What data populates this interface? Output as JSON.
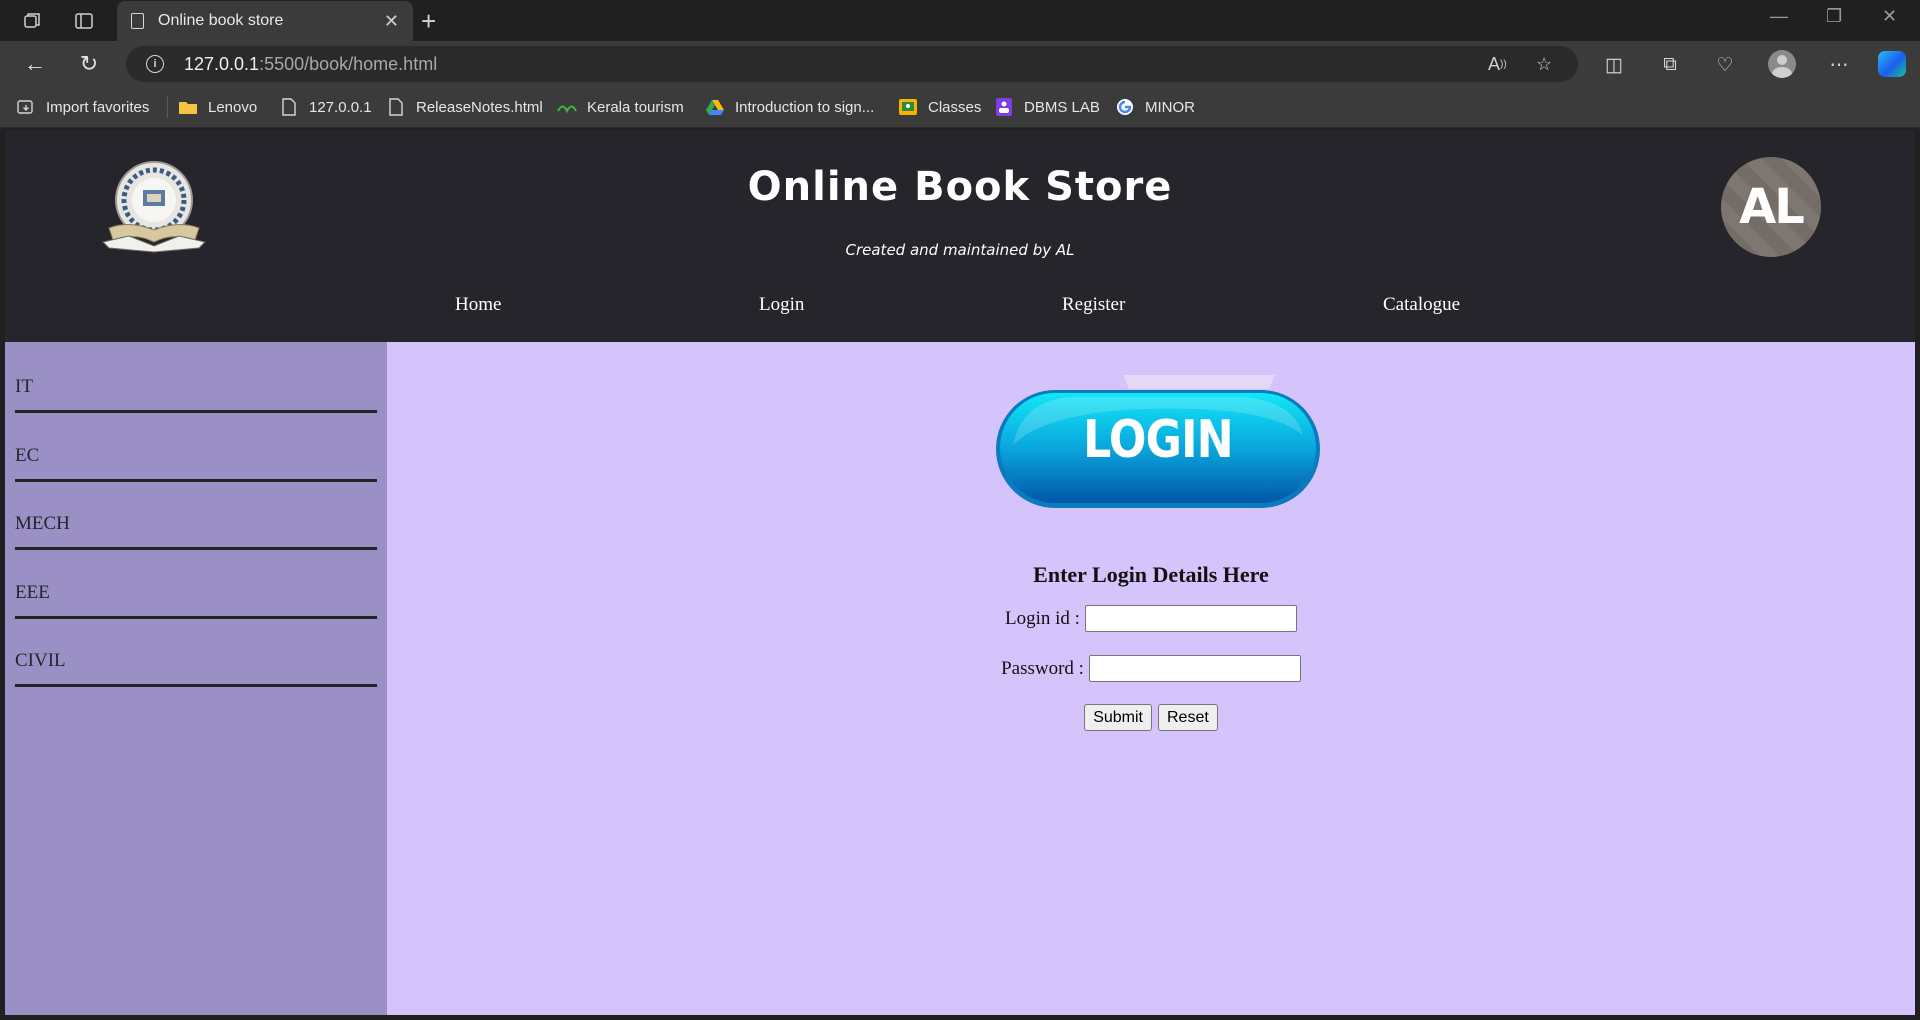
{
  "browser": {
    "tab_title": "Online book store",
    "url_host": "127.0.0.1",
    "url_path": ":5500/book/home.html",
    "bookmarks": [
      {
        "label": "Import favorites",
        "icon": "import-icon"
      },
      {
        "label": "Lenovo",
        "icon": "folder-icon"
      },
      {
        "label": "127.0.0.1",
        "icon": "page-icon"
      },
      {
        "label": "ReleaseNotes.html",
        "icon": "page-icon"
      },
      {
        "label": "Kerala tourism",
        "icon": "kerala-icon"
      },
      {
        "label": "Introduction to sign...",
        "icon": "drive-icon"
      },
      {
        "label": "Classes",
        "icon": "classroom-icon"
      },
      {
        "label": "DBMS LAB",
        "icon": "forms-icon"
      },
      {
        "label": "MINOR",
        "icon": "google-icon"
      }
    ]
  },
  "header": {
    "title": "Online Book Store",
    "subtitle": "Created and maintained by AL",
    "avatar_text": "AL",
    "nav": [
      "Home",
      "Login",
      "Register",
      "Catalogue"
    ]
  },
  "sidebar": {
    "items": [
      "IT",
      "EC",
      "MECH",
      "EEE",
      "CIVIL"
    ]
  },
  "login": {
    "banner_text": "LOGIN",
    "heading": "Enter Login Details Here",
    "login_id_label": "Login id :",
    "login_id_value": "",
    "password_label": "Password :",
    "password_value": "",
    "submit_label": "Submit",
    "reset_label": "Reset"
  },
  "colors": {
    "header_bg": "#26252b",
    "sidebar_bg": "#9a90c6",
    "main_bg": "#d5c4fb",
    "login_pill": "#0a9ad8"
  }
}
